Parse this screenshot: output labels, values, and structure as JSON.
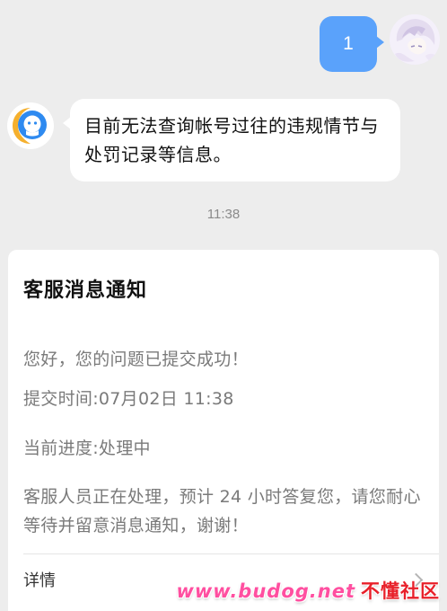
{
  "outgoing": {
    "text": "1"
  },
  "incoming": {
    "text": "目前无法查询帐号过往的违规情节与处罚记录等信息。"
  },
  "timestamp": "11:38",
  "notice": {
    "title": "客服消息通知",
    "greeting": "您好，您的问题已提交成功！",
    "submit_time": "提交时间:07月02日 11:38",
    "progress": "当前进度:处理中",
    "body": "客服人员正在处理，预计 24 小时答复您，请您耐心等待并留意消息通知，谢谢！",
    "detail_label": "详情"
  },
  "watermark": {
    "site": "www.budog.net",
    "name": "不懂社区"
  },
  "colors": {
    "background": "#EDEDED",
    "outgoing_bubble": "#5AA2FB",
    "bubble": "#FFFFFF",
    "watermark_pink": "#FF4FA0",
    "watermark_red": "#E8202A"
  },
  "icons": {
    "bot_avatar": "customer-service-icon",
    "user_avatar": "anime-avatar",
    "detail": "chevron-right-icon"
  }
}
